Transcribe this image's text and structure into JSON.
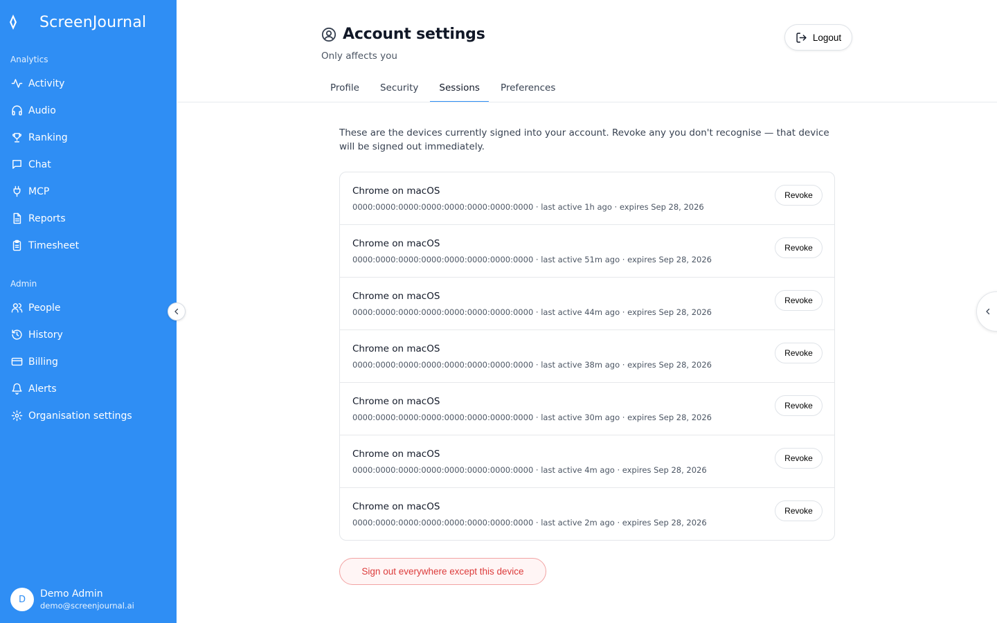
{
  "app": {
    "name": "ScreenJournal"
  },
  "sidebar": {
    "sections": [
      {
        "label": "Analytics"
      },
      {
        "label": "Admin"
      }
    ],
    "analytics_items": [
      {
        "label": "Activity",
        "icon": "activity-icon"
      },
      {
        "label": "Audio",
        "icon": "headphones-icon"
      },
      {
        "label": "Ranking",
        "icon": "trophy-icon"
      },
      {
        "label": "Chat",
        "icon": "chat-icon"
      },
      {
        "label": "MCP",
        "icon": "plug-icon"
      },
      {
        "label": "Reports",
        "icon": "document-icon"
      },
      {
        "label": "Timesheet",
        "icon": "clipboard-icon"
      }
    ],
    "admin_items": [
      {
        "label": "People",
        "icon": "users-icon"
      },
      {
        "label": "History",
        "icon": "history-icon"
      },
      {
        "label": "Billing",
        "icon": "credit-card-icon"
      },
      {
        "label": "Alerts",
        "icon": "bell-icon"
      },
      {
        "label": "Organisation settings",
        "icon": "gear-icon"
      }
    ],
    "user": {
      "initial": "D",
      "name": "Demo Admin",
      "email": "demo@screenjournal.ai"
    }
  },
  "header": {
    "title": "Account settings",
    "subtitle": "Only affects you",
    "logout_label": "Logout"
  },
  "tabs": [
    {
      "label": "Profile",
      "active": false
    },
    {
      "label": "Security",
      "active": false
    },
    {
      "label": "Sessions",
      "active": true
    },
    {
      "label": "Preferences",
      "active": false
    }
  ],
  "intro": "These are the devices currently signed into your account. Revoke any you don't recognise — that device will be signed out immediately.",
  "sessions": [
    {
      "device": "Chrome on macOS",
      "meta": "0000:0000:0000:0000:0000:0000:0000:0000 · last active 1h ago · expires Sep 28, 2026",
      "revoke_label": "Revoke"
    },
    {
      "device": "Chrome on macOS",
      "meta": "0000:0000:0000:0000:0000:0000:0000:0000 · last active 51m ago · expires Sep 28, 2026",
      "revoke_label": "Revoke"
    },
    {
      "device": "Chrome on macOS",
      "meta": "0000:0000:0000:0000:0000:0000:0000:0000 · last active 44m ago · expires Sep 28, 2026",
      "revoke_label": "Revoke"
    },
    {
      "device": "Chrome on macOS",
      "meta": "0000:0000:0000:0000:0000:0000:0000:0000 · last active 38m ago · expires Sep 28, 2026",
      "revoke_label": "Revoke"
    },
    {
      "device": "Chrome on macOS",
      "meta": "0000:0000:0000:0000:0000:0000:0000:0000 · last active 30m ago · expires Sep 28, 2026",
      "revoke_label": "Revoke"
    },
    {
      "device": "Chrome on macOS",
      "meta": "0000:0000:0000:0000:0000:0000:0000:0000 · last active 4m ago · expires Sep 28, 2026",
      "revoke_label": "Revoke"
    },
    {
      "device": "Chrome on macOS",
      "meta": "0000:0000:0000:0000:0000:0000:0000:0000 · last active 2m ago · expires Sep 28, 2026",
      "revoke_label": "Revoke"
    }
  ],
  "signout_all_label": "Sign out everywhere except this device",
  "colors": {
    "sidebar_bg": "#2f8ef4",
    "accent": "#2f8ef4",
    "danger": "#dc3b3b"
  }
}
